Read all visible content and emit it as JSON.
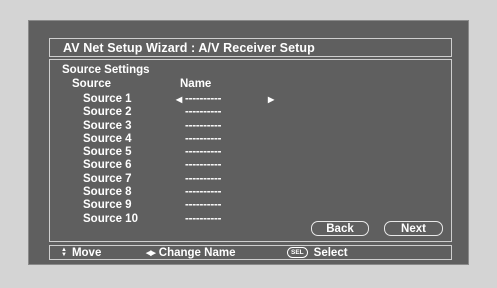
{
  "window": {
    "title": "AV Net Setup Wizard : A/V Receiver Setup"
  },
  "panel": {
    "section_title": "Source Settings",
    "columns": {
      "source": "Source",
      "name": "Name"
    },
    "rows": [
      {
        "label": "Source 1",
        "value": "----------",
        "selected": true
      },
      {
        "label": "Source 2",
        "value": "----------"
      },
      {
        "label": "Source 3",
        "value": "----------"
      },
      {
        "label": "Source 4",
        "value": "----------"
      },
      {
        "label": "Source 5",
        "value": "----------"
      },
      {
        "label": "Source 6",
        "value": "----------"
      },
      {
        "label": "Source 7",
        "value": "----------"
      },
      {
        "label": "Source 8",
        "value": "----------"
      },
      {
        "label": "Source 9",
        "value": "----------"
      },
      {
        "label": "Source 10",
        "value": "----------"
      }
    ],
    "selection_arrows": {
      "left": "◀",
      "right": "▶"
    },
    "buttons": {
      "back": "Back",
      "next": "Next"
    }
  },
  "helpbar": {
    "move_icon": "up-down-arrows-icon",
    "move_label": "Move",
    "change_icon": "left-right-arrows-icon",
    "change_label": "Change Name",
    "select_icon_text": "SEL",
    "select_label": "Select"
  },
  "colors": {
    "screen_background": "#5f5f5f",
    "outer_background": "#d4d4d4",
    "text": "#ffffff",
    "border": "#cfcfcf"
  }
}
